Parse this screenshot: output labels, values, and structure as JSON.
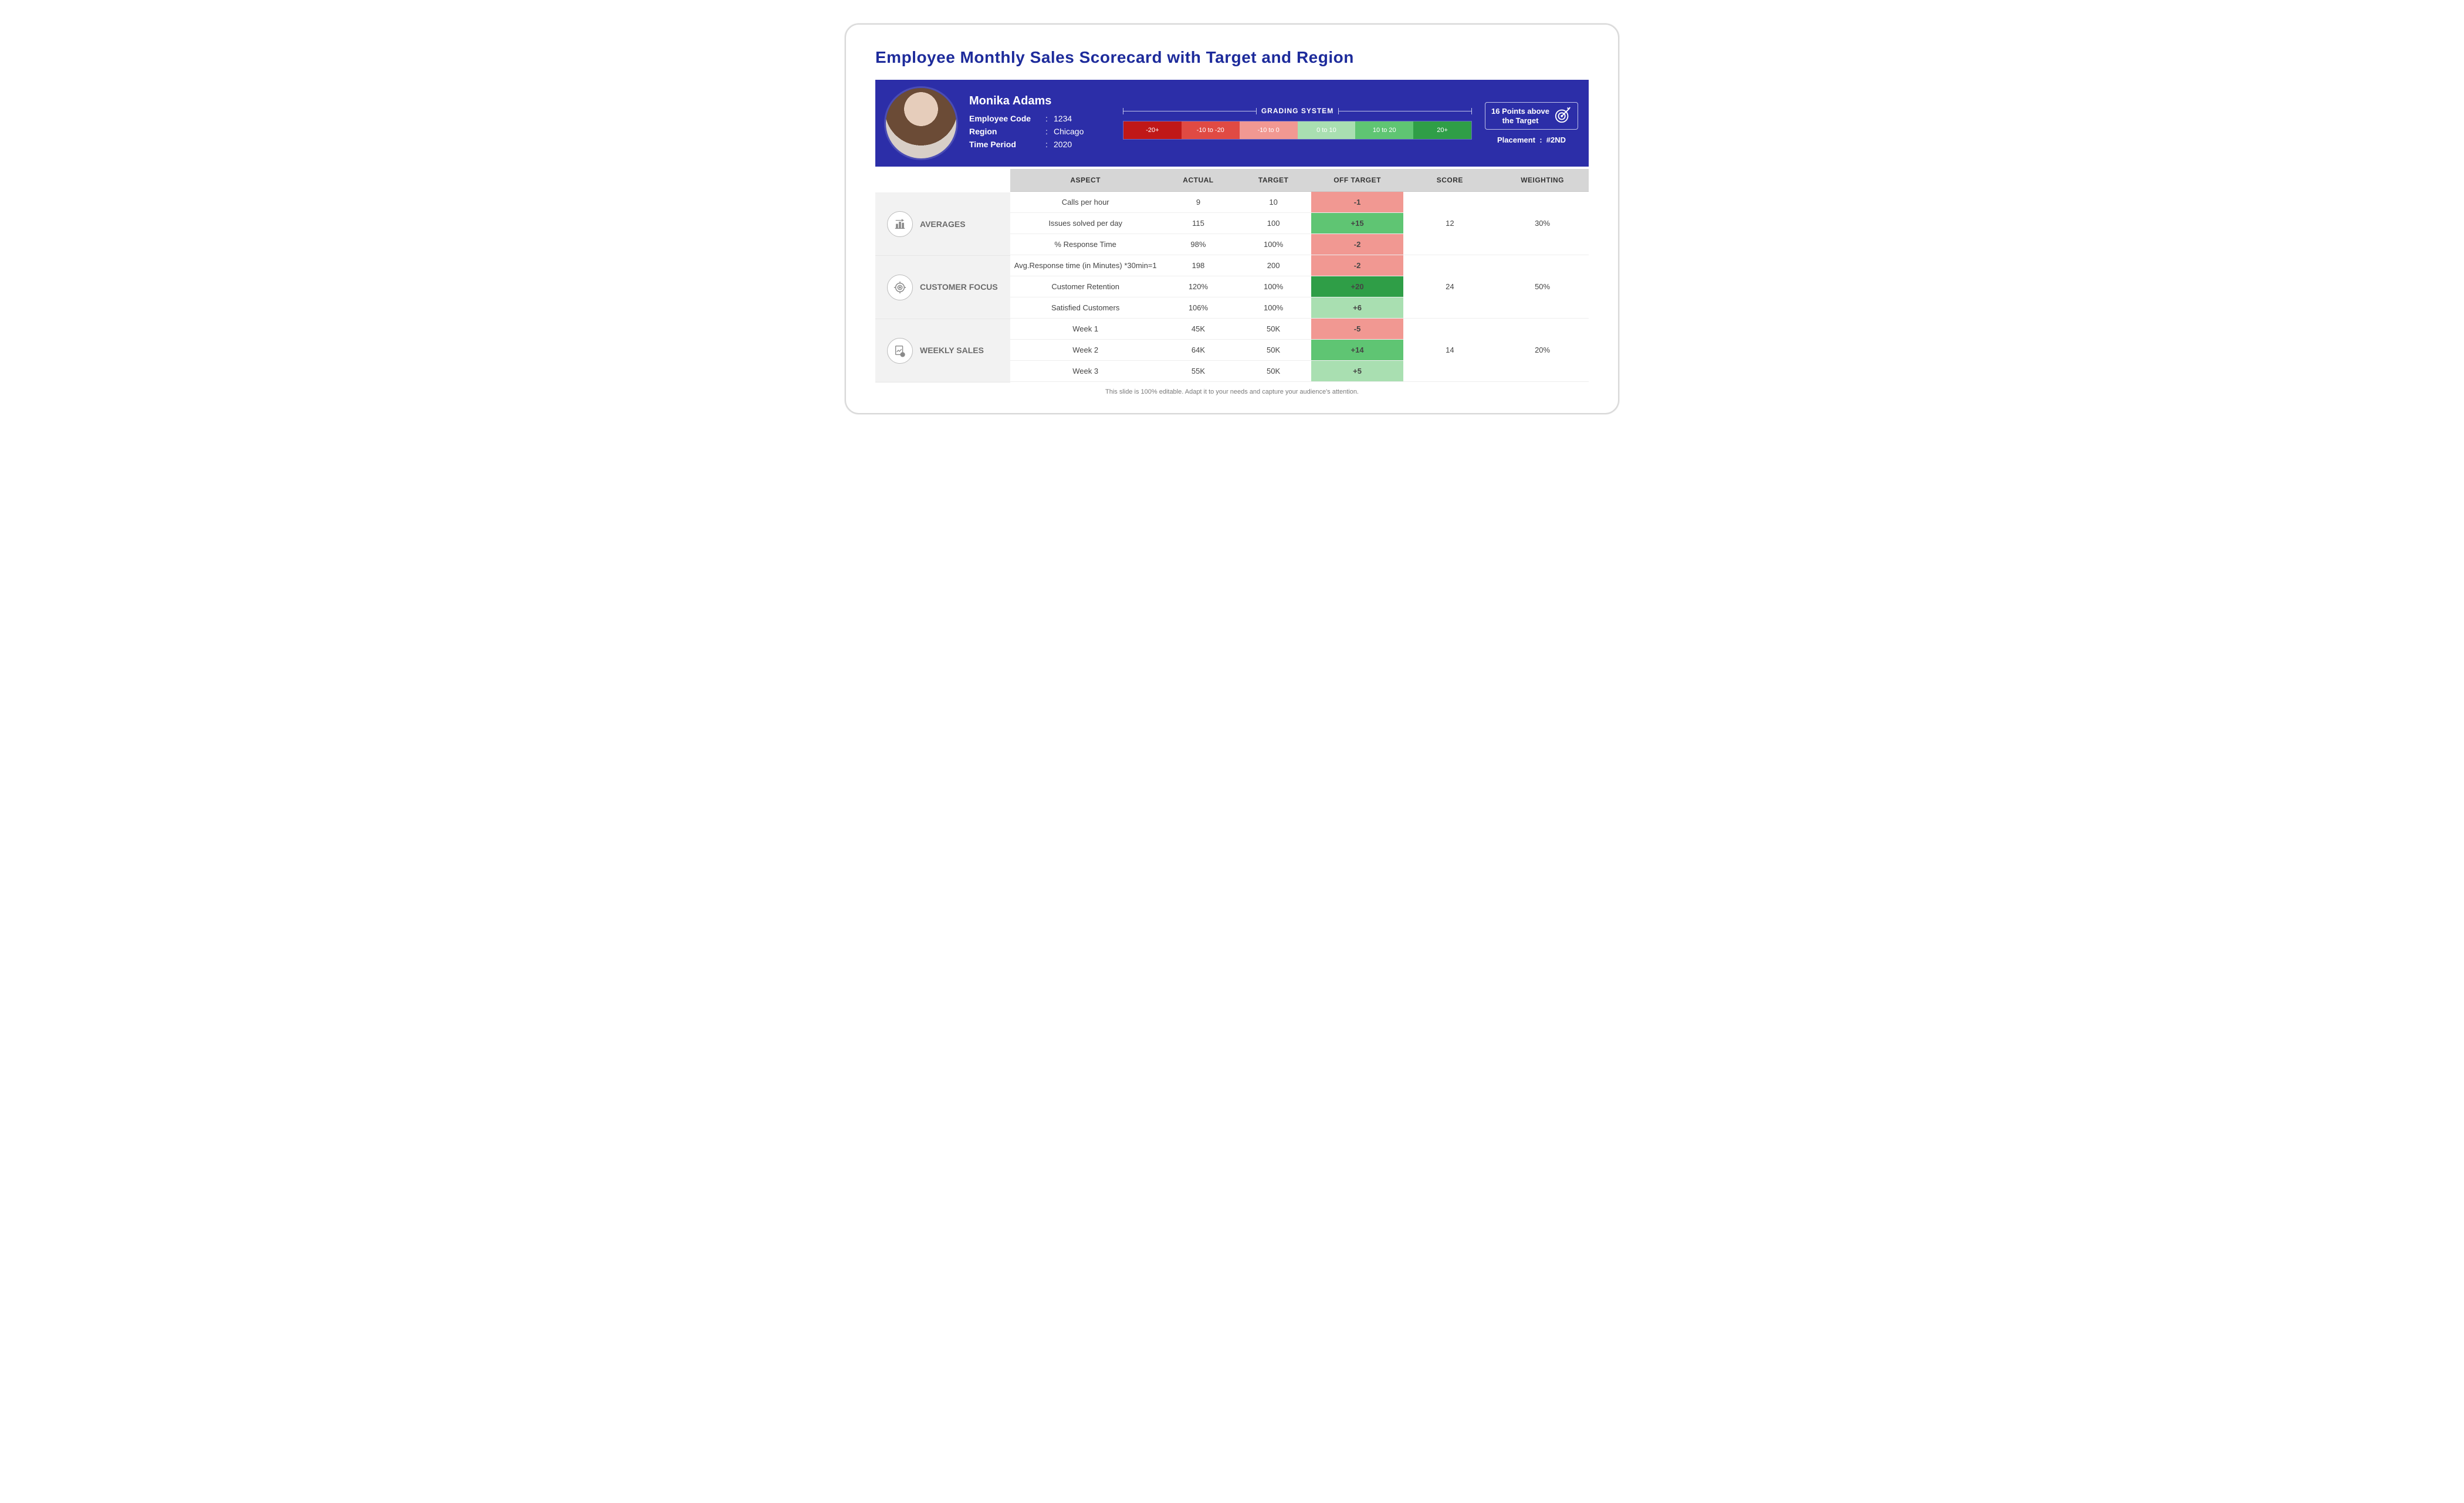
{
  "title": "Employee Monthly Sales Scorecard with Target and Region",
  "employee": {
    "name": "Monika Adams",
    "labels": {
      "code": "Employee Code",
      "region": "Region",
      "period": "Time Period"
    },
    "code": "1234",
    "region": "Chicago",
    "period": "2020"
  },
  "grading": {
    "title": "GRADING SYSTEM",
    "cells": [
      "-20+",
      "-10 to -20",
      "-10 to 0",
      "0 to 10",
      "10 to 20",
      "20+"
    ]
  },
  "summary": {
    "points_line1": "16 Points above",
    "points_line2": "the Target",
    "placement_label": "Placement",
    "placement_value": "#2ND"
  },
  "table": {
    "headers": [
      "ASPECT",
      "ACTUAL",
      "TARGET",
      "OFF TARGET",
      "SCORE",
      "WEIGHTING"
    ],
    "categories": [
      {
        "name": "AVERAGES",
        "icon": "bar-chart-icon",
        "score": "12",
        "weighting": "30%",
        "rows": [
          {
            "aspect": "Calls per hour",
            "actual": "9",
            "target": "10",
            "off": "-1",
            "off_class": "ot-neg1"
          },
          {
            "aspect": "Issues solved per day",
            "actual": "115",
            "target": "100",
            "off": "+15",
            "off_class": "ot-pos2"
          },
          {
            "aspect": "% Response Time",
            "actual": "98%",
            "target": "100%",
            "off": "-2",
            "off_class": "ot-neg1"
          }
        ]
      },
      {
        "name": "CUSTOMER FOCUS",
        "icon": "target-icon",
        "score": "24",
        "weighting": "50%",
        "rows": [
          {
            "aspect": "Avg.Response time (in Minutes) *30min=1",
            "actual": "198",
            "target": "200",
            "off": "-2",
            "off_class": "ot-neg1"
          },
          {
            "aspect": "Customer Retention",
            "actual": "120%",
            "target": "100%",
            "off": "+20",
            "off_class": "ot-pos3"
          },
          {
            "aspect": "Satisfied Customers",
            "actual": "106%",
            "target": "100%",
            "off": "+6",
            "off_class": "ot-pos1"
          }
        ]
      },
      {
        "name": "WEEKLY SALES",
        "icon": "sales-report-icon",
        "score": "14",
        "weighting": "20%",
        "rows": [
          {
            "aspect": "Week 1",
            "actual": "45K",
            "target": "50K",
            "off": "-5",
            "off_class": "ot-neg1"
          },
          {
            "aspect": "Week 2",
            "actual": "64K",
            "target": "50K",
            "off": "+14",
            "off_class": "ot-pos2"
          },
          {
            "aspect": "Week 3",
            "actual": "55K",
            "target": "50K",
            "off": "+5",
            "off_class": "ot-pos1"
          }
        ]
      }
    ]
  },
  "footnote": "This slide is 100% editable. Adapt it to your needs and capture your audience's attention."
}
